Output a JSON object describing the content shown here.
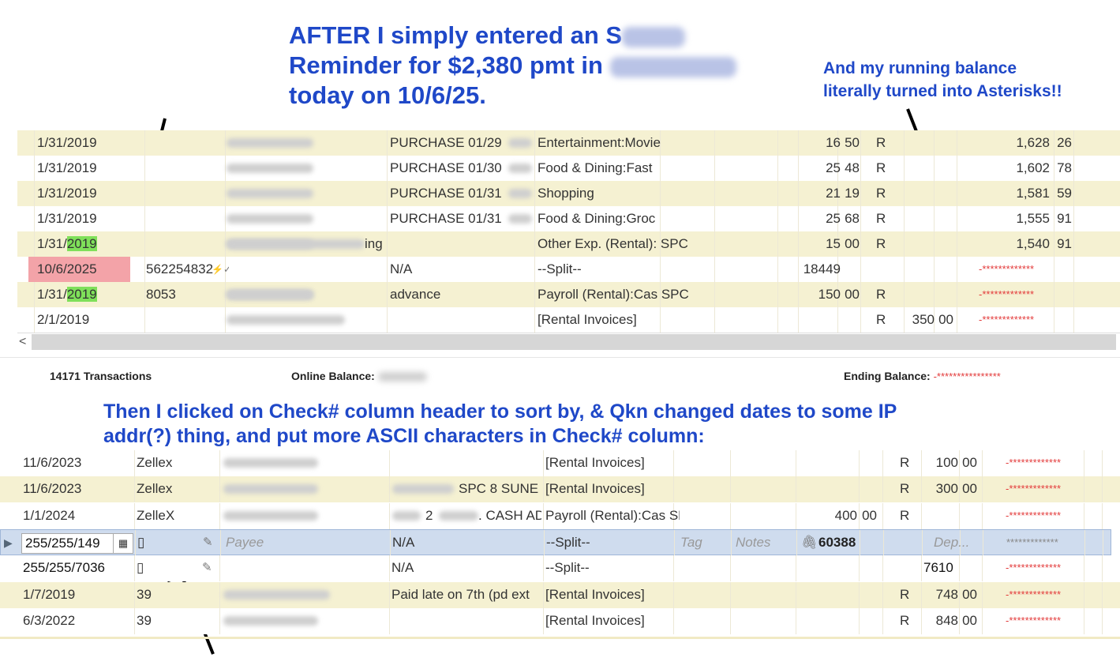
{
  "annotations": {
    "title_line1": "AFTER I simply entered an S",
    "title_line2": "Reminder for $2,380 pmt in",
    "title_line3": "today on 10/6/25.",
    "right_line1": "And my running balance",
    "right_line2": "literally turned into Asterisks!!",
    "mid_line1": "Then I clicked on Check# column header to sort by, & Qkn changed dates to some IP",
    "mid_line2": "addr(?) thing, and put more ASCII characters in Check# column:"
  },
  "register_top": {
    "rows": [
      {
        "date": "1/31/2019",
        "check": "",
        "memo": "PURCHASE 01/29",
        "category": "Entertainment:Movie",
        "amount": "16",
        "cents": "50",
        "clr": "R",
        "deposit": "",
        "deposit_cents": "",
        "balance": "1,628",
        "balance_cents": "26"
      },
      {
        "date": "1/31/2019",
        "check": "",
        "memo": "PURCHASE 01/30",
        "category": "Food & Dining:Fast",
        "amount": "25",
        "cents": "48",
        "clr": "R",
        "deposit": "",
        "deposit_cents": "",
        "balance": "1,602",
        "balance_cents": "78"
      },
      {
        "date": "1/31/2019",
        "check": "",
        "memo": "PURCHASE 01/31",
        "category": "Shopping",
        "amount": "21",
        "cents": "19",
        "clr": "R",
        "deposit": "",
        "deposit_cents": "",
        "balance": "1,581",
        "balance_cents": "59"
      },
      {
        "date": "1/31/2019",
        "check": "",
        "memo": "PURCHASE 01/31",
        "category": "Food & Dining:Groc",
        "amount": "25",
        "cents": "68",
        "clr": "R",
        "deposit": "",
        "deposit_cents": "",
        "balance": "1,555",
        "balance_cents": "91"
      },
      {
        "date_a": "1/31/",
        "date_b": "2019",
        "check": "",
        "payee_tail": "ing",
        "memo": "",
        "category": "Other Exp. (Rental): SPC",
        "amount": "15",
        "cents": "00",
        "clr": "R",
        "deposit": "",
        "deposit_cents": "",
        "balance": "1,540",
        "balance_cents": "91"
      },
      {
        "date": "10/6/2025",
        "check": "562254832",
        "check_glyph": "⚡✓",
        "memo": "N/A",
        "category": "--Split--",
        "amount": "18449",
        "cents": "",
        "clr": "",
        "deposit": "",
        "deposit_cents": "",
        "balance": "-*************",
        "balance_cents": ""
      },
      {
        "date_a": "1/31/",
        "date_b": "2019",
        "check": "8053",
        "memo": "advance",
        "category": "Payroll (Rental):Cas SPC",
        "amount": "150",
        "cents": "00",
        "clr": "R",
        "deposit": "",
        "deposit_cents": "",
        "balance": "-*************",
        "balance_cents": ""
      },
      {
        "date": "2/1/2019",
        "check": "",
        "memo": "",
        "category": "[Rental Invoices]",
        "amount": "",
        "cents": "",
        "clr": "R",
        "deposit": "350",
        "deposit_cents": "00",
        "balance": "-*************",
        "balance_cents": ""
      }
    ]
  },
  "scrollbar": {
    "left_arrow": "<"
  },
  "status_bar": {
    "transactions": "14171 Transactions",
    "online_balance_label": "Online Balance:",
    "ending_balance_label": "Ending Balance:",
    "ending_balance_value": "-****************"
  },
  "register_bottom": {
    "rows": [
      {
        "date": "11/6/2023",
        "check": "Zellex",
        "memo": "",
        "category": "[Rental Invoices]",
        "amount": "",
        "cents": "",
        "clr": "R",
        "deposit": "100",
        "deposit_cents": "00",
        "balance": "-*************"
      },
      {
        "date": "11/6/2023",
        "check": "Zellex",
        "memo": "SPC 8 SUNE",
        "category": "[Rental Invoices]",
        "amount": "",
        "cents": "",
        "clr": "R",
        "deposit": "300",
        "deposit_cents": "00",
        "balance": "-*************"
      },
      {
        "date": "1/1/2024",
        "check": "ZelleX",
        "memo_a": "2",
        "memo_b": ". CASH AD",
        "category": "Payroll (Rental):Cas SPC",
        "amount": "400",
        "cents": "00",
        "clr": "R",
        "deposit": "",
        "deposit_cents": "",
        "balance": "-*************"
      },
      {
        "date": "255/255/149",
        "check": "▯",
        "payee_placeholder": "Payee",
        "memo": "N/A",
        "category": "--Split--",
        "tag_placeholder": "Tag",
        "notes_placeholder": "Notes",
        "amount": "60388",
        "deposit_placeholder": "Dep...",
        "balance": "*************"
      },
      {
        "date": "255/255/7036",
        "check": "▯",
        "memo": "N/A",
        "category": "--Split--",
        "deposit": "7610",
        "balance": "-*************"
      },
      {
        "date": "1/7/2019",
        "check": "39",
        "memo": "Paid late on 7th (pd ext",
        "category": "[Rental Invoices]",
        "clr": "R",
        "deposit": "748",
        "deposit_cents": "00",
        "balance": "-*************"
      },
      {
        "date": "6/3/2022",
        "check": "39",
        "memo": "",
        "category": "[Rental Invoices]",
        "clr": "R",
        "deposit": "848",
        "deposit_cents": "00",
        "balance": "-*************"
      }
    ]
  },
  "icons": {
    "calendar": "calendar-icon",
    "edit": "edit-note-icon",
    "attach": "paperclip-icon",
    "row_marker": "row-pointer-icon"
  }
}
